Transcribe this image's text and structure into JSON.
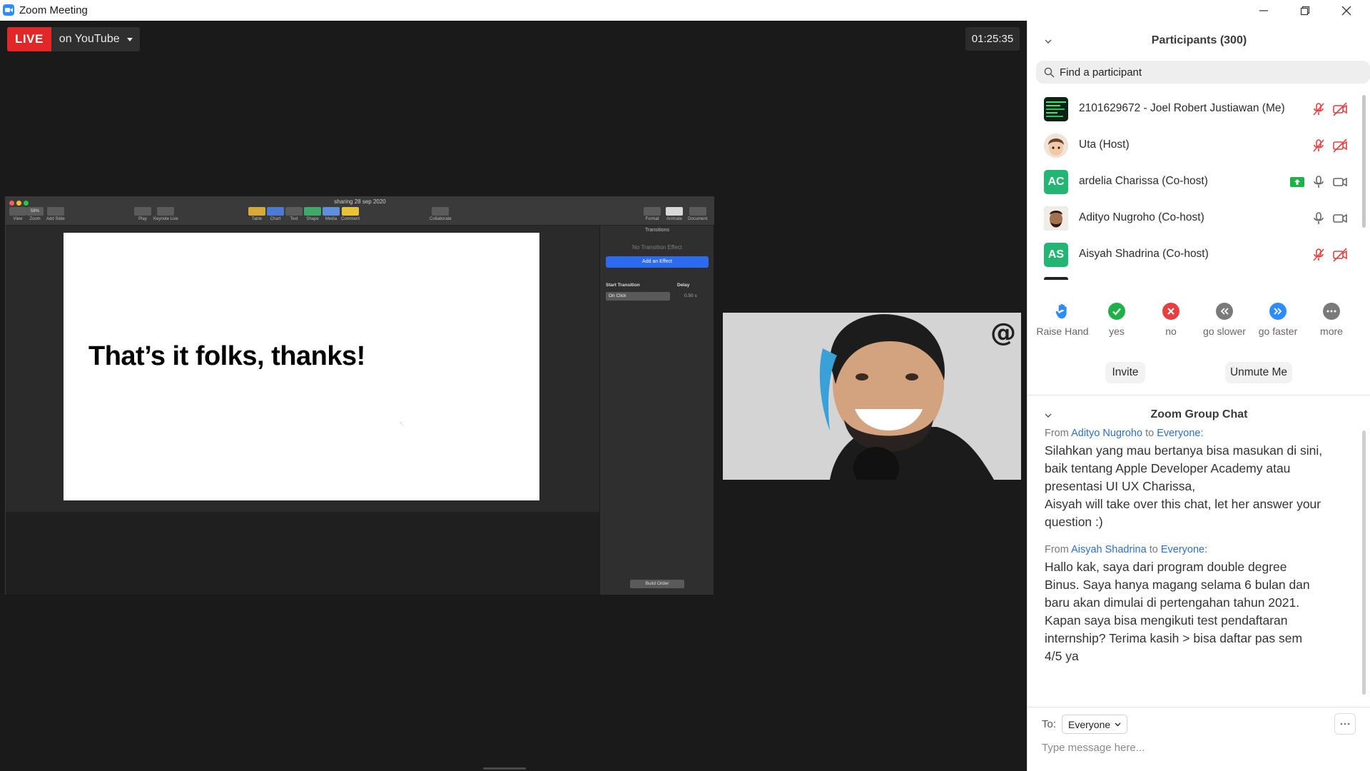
{
  "window": {
    "title": "Zoom Meeting",
    "controls": [
      "minimize",
      "restore",
      "close"
    ]
  },
  "stage": {
    "live_label": "LIVE",
    "stream_target": "on YouTube",
    "elapsed_time": "01:25:35"
  },
  "shared_screen": {
    "doc_title": "sharing 28 sep 2020",
    "toolbar": [
      "View",
      "Zoom",
      "Add Slide",
      "Play",
      "Keynote Live",
      "Table",
      "Chart",
      "Text",
      "Shape",
      "Media",
      "Comment",
      "Collaborate",
      "Format",
      "Animate",
      "Document"
    ],
    "zoom_value": "58%",
    "slide_headline": "That’s it folks, thanks!",
    "inspector": {
      "title": "Transitions",
      "no_effect": "No Transition Effect",
      "add_effect": "Add an Effect",
      "start_transition_label": "Start Transition",
      "delay_label": "Delay",
      "start_transition_value": "On Click",
      "delay_value": "0.50 s",
      "build_order": "Build Order"
    }
  },
  "participants": {
    "heading": "Participants (300)",
    "search_placeholder": "Find a participant",
    "list": [
      {
        "name": "2101629672 - Joel Robert Justiawan (Me)",
        "avatar": "photo",
        "mic": "muted",
        "video": "off"
      },
      {
        "name": "Uta (Host)",
        "avatar": "photo",
        "mic": "muted",
        "video": "off"
      },
      {
        "name": "ardelia Charissa (Co-host)",
        "avatar": "AC",
        "avatar_color": "#22b573",
        "sharing": true,
        "mic": "on",
        "video": "on"
      },
      {
        "name": "Adityo Nugroho (Co-host)",
        "avatar": "photo",
        "mic": "on",
        "video": "on"
      },
      {
        "name": "Aisyah Shadrina (Co-host)",
        "avatar": "AS",
        "avatar_color": "#22b573",
        "mic": "muted",
        "video": "off"
      }
    ],
    "reactions": [
      {
        "label": "Raise Hand",
        "icon": "raise-hand-icon"
      },
      {
        "label": "yes",
        "icon": "check-icon",
        "color": "#20b04a"
      },
      {
        "label": "no",
        "icon": "x-icon",
        "color": "#e54040"
      },
      {
        "label": "go slower",
        "icon": "rewind-icon",
        "color": "#7a7a7a"
      },
      {
        "label": "go faster",
        "icon": "fast-forward-icon",
        "color": "#2d8cff"
      },
      {
        "label": "more",
        "icon": "more-icon",
        "color": "#7a7a7a"
      }
    ],
    "invite_label": "Invite",
    "unmute_label": "Unmute Me"
  },
  "chat": {
    "heading": "Zoom Group Chat",
    "messages": [
      {
        "from_prefix": "From",
        "from": "Adityo Nugroho",
        "to_prefix": "to",
        "to": "Everyone:",
        "body": "Silahkan yang mau bertanya bisa masukan di sini,\nbaik tentang Apple Developer Academy atau\npresentasi UI UX Charissa,\nAisyah will take over this chat, let her answer your\nquestion :)"
      },
      {
        "from_prefix": "From",
        "from": "Aisyah Shadrina",
        "to_prefix": "to",
        "to": "Everyone:",
        "body": "Hallo kak, saya dari program double degree\nBinus. Saya hanya magang selama 6 bulan dan\nbaru akan dimulai di pertengahan tahun 2021.\nKapan saya bisa mengikuti test pendaftaran\ninternship? Terima kasih > bisa daftar pas sem\n4/5 ya"
      }
    ],
    "to_label": "To:",
    "to_value": "Everyone",
    "input_placeholder": "Type message here..."
  },
  "colors": {
    "accent": "#2d8cff",
    "live_red": "#e02828",
    "stage_bg": "#1a1a1a",
    "muted_red": "#e54040",
    "share_green": "#20b04a"
  }
}
